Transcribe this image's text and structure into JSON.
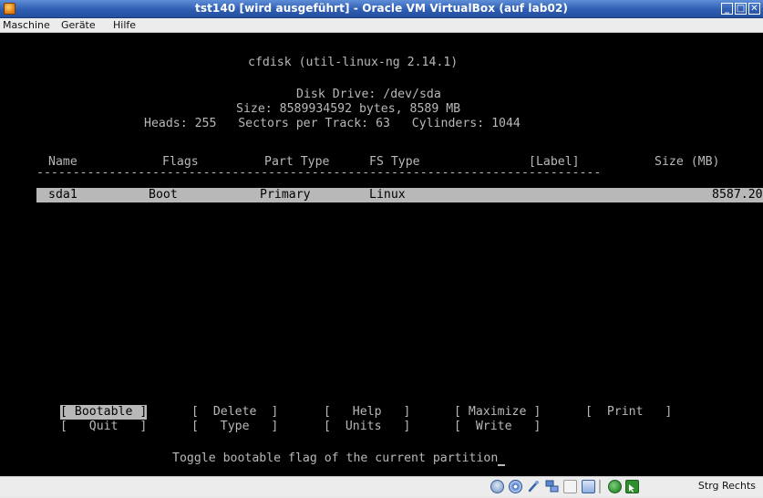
{
  "window": {
    "title": "tst140 [wird ausgeführt] - Oracle VM VirtualBox (auf lab02)",
    "controls": {
      "minimize": "_",
      "maximize": "□",
      "close": "✕"
    }
  },
  "menubar": {
    "items": [
      {
        "label": "Maschine"
      },
      {
        "label": "Geräte"
      },
      {
        "label": "Hilfe"
      }
    ]
  },
  "terminal": {
    "program": "cfdisk (util-linux-ng 2.14.1)",
    "disk_drive": "Disk Drive: /dev/sda",
    "size_line": "Size: 8589934592 bytes, 8589 MB",
    "geometry_line": "Heads: 255   Sectors per Track: 63   Cylinders: 1044",
    "columns": [
      "Name",
      "Flags",
      "Part Type",
      "FS Type",
      "[Label]",
      "Size (MB)"
    ],
    "separator": "------------------------------------------------------------------------------",
    "partitions": [
      {
        "name": "sda1",
        "flags": "Boot",
        "part_type": "Primary",
        "fs_type": "Linux",
        "label": "",
        "size": "8587.20"
      }
    ],
    "actions_row1": [
      "[ Bootable ]",
      "[  Delete  ]",
      "[   Help   ]",
      "[ Maximize ]",
      "[  Print   ]"
    ],
    "actions_row2": [
      "[   Quit   ]",
      "[   Type   ]",
      "[  Units   ]",
      "[  Write   ]"
    ],
    "selected_action": "[ Bootable ]",
    "hint": "Toggle bootable flag of the current partition"
  },
  "statusbar": {
    "host_key": "Strg Rechts",
    "icons": [
      "hard-disk-icon",
      "cd-drive-icon",
      "usb-icon",
      "network-icon",
      "shared-folder-icon",
      "display-icon",
      "virtualization-icon",
      "mouse-integration-icon"
    ]
  },
  "colors": {
    "titlebar": "#2f5eb2",
    "terminal_bg": "#000000",
    "terminal_fg": "#b8b8b8",
    "highlight_bg": "#b8b8b8"
  }
}
